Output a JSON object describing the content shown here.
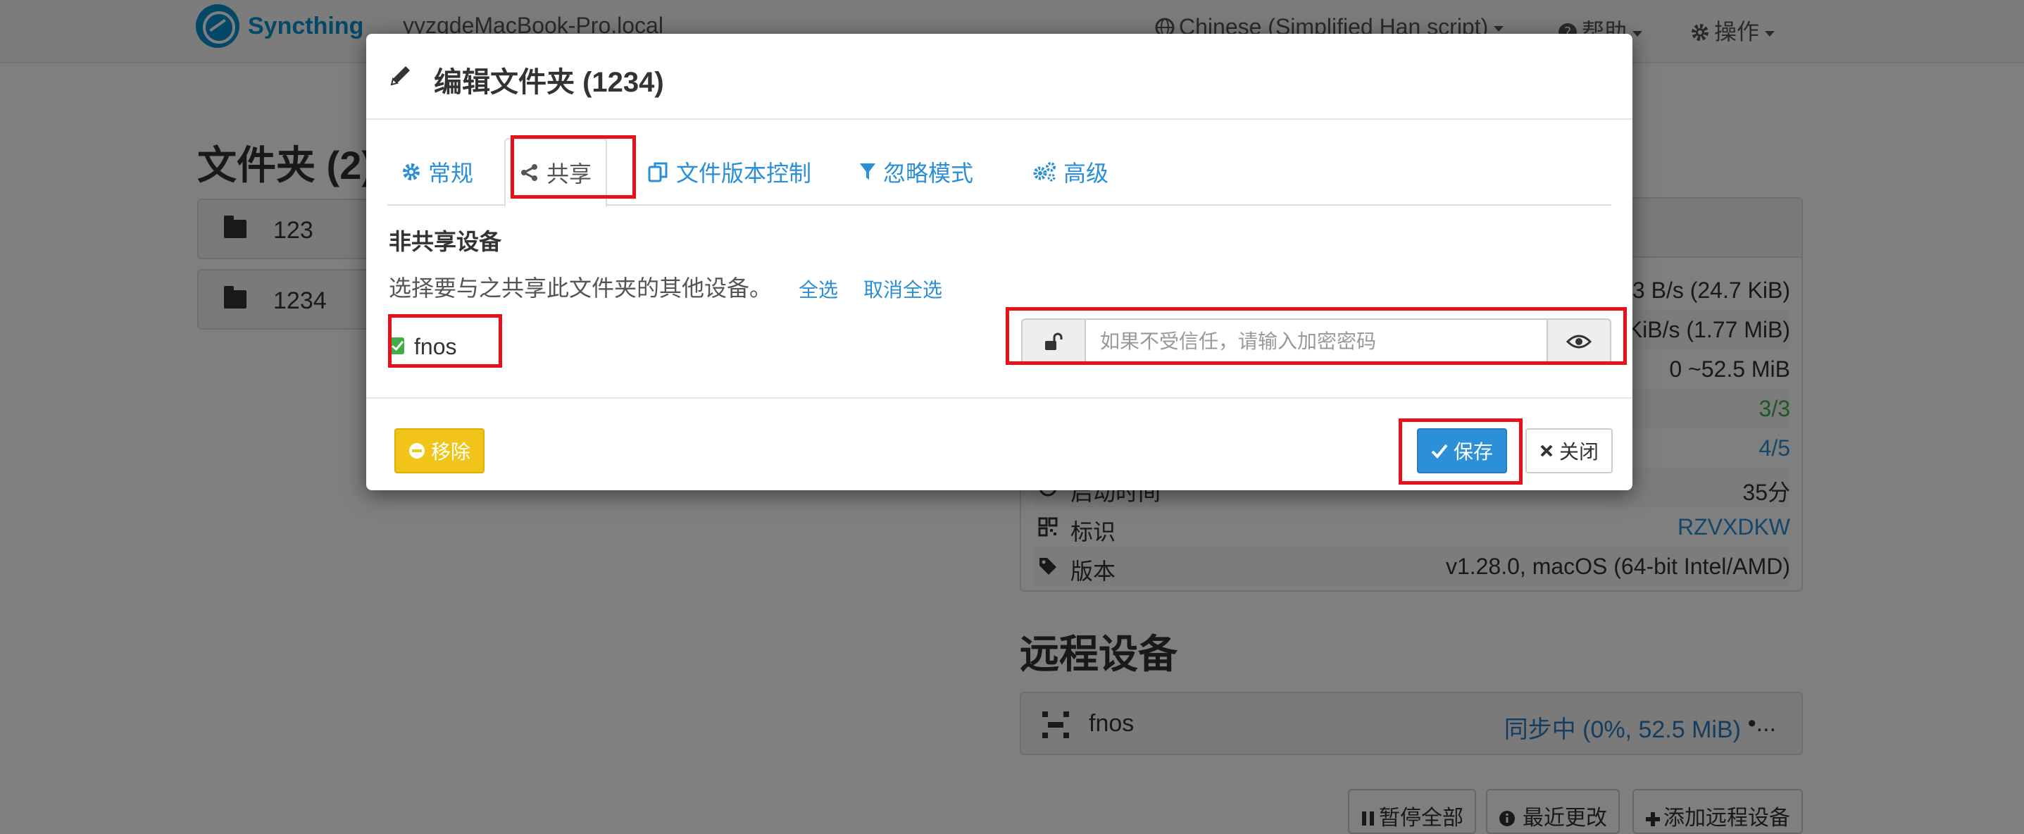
{
  "navbar": {
    "brand": "Syncthing",
    "hostname": "yyzqdeMacBook-Pro.local",
    "language": "Chinese (Simplified Han script)",
    "help": "帮助",
    "actions": "操作"
  },
  "folders": {
    "heading": "文件夹 (2)",
    "items": [
      {
        "name": "123"
      },
      {
        "name": "1234"
      }
    ]
  },
  "this_device": {
    "rows": [
      {
        "label": "",
        "value": "3 B/s (24.7 KiB)"
      },
      {
        "label": "",
        "value": "KiB/s (1.77 MiB)"
      },
      {
        "label": "",
        "value": "0  ~52.5 MiB"
      },
      {
        "label": "",
        "value": "3/3"
      },
      {
        "label": "",
        "value": "4/5"
      },
      {
        "label": "启动时间",
        "value": "35分"
      },
      {
        "label": "标识",
        "value": "RZVXDKW"
      },
      {
        "label": "版本",
        "value": "v1.28.0, macOS (64-bit Intel/AMD)"
      }
    ]
  },
  "remote": {
    "heading": "远程设备",
    "device_name": "fnos",
    "status": "同步中 (0%, 52.5 MiB)",
    "dots": "•..."
  },
  "bottom_buttons": {
    "pause_all": "暂停全部",
    "recent_changes": "最近更改",
    "add_device": "添加远程设备"
  },
  "modal": {
    "title": "编辑文件夹 (1234)",
    "tabs": [
      {
        "label": "常规"
      },
      {
        "label": "共享"
      },
      {
        "label": "文件版本控制"
      },
      {
        "label": "忽略模式"
      },
      {
        "label": "高级"
      }
    ],
    "section_title": "非共享设备",
    "help_text": "选择要与之共享此文件夹的其他设备。",
    "select_all": "全选",
    "deselect_all": "取消全选",
    "device": {
      "name": "fnos",
      "checked": true
    },
    "password_placeholder": "如果不受信任，请输入加密密码",
    "remove_button": "移除",
    "save_button": "保存",
    "close_button": "关闭"
  },
  "colors": {
    "accent": "#2a8fd6",
    "warning": "#f0c419",
    "highlight": "#e8111b",
    "success": "#3fae49"
  }
}
